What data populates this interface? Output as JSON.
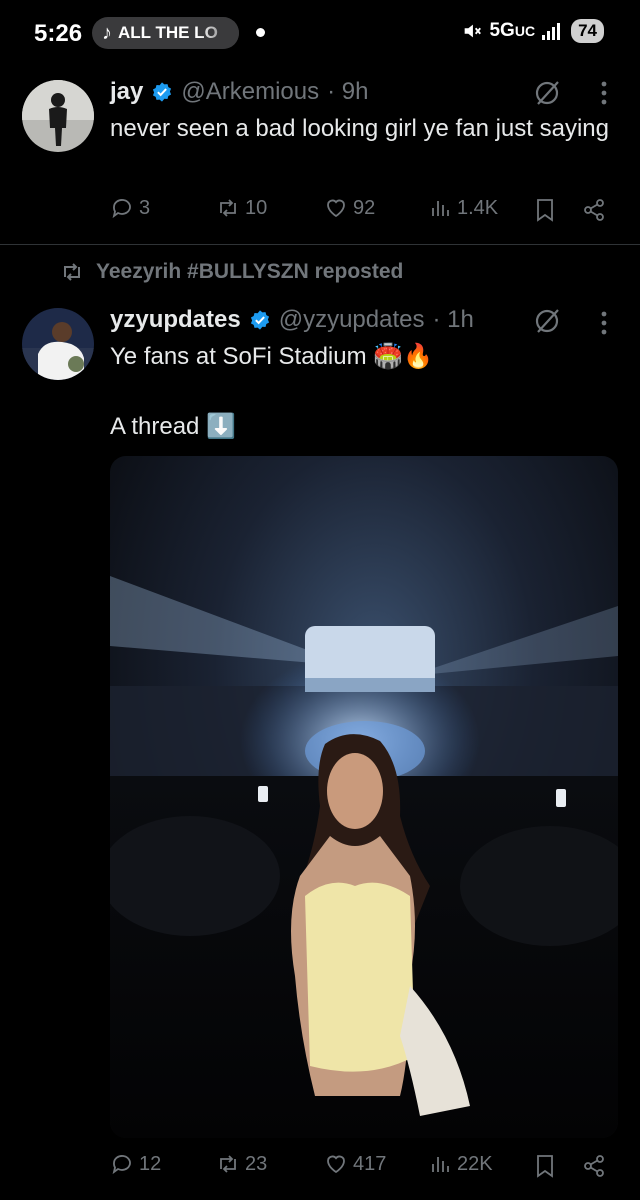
{
  "status_bar": {
    "time": "5:26",
    "media_label": "ALL THE LO",
    "network": "5G",
    "network_suffix": "UC",
    "battery": "74"
  },
  "tweet1": {
    "name": "jay",
    "handle": "@Arkemious",
    "time": "· 9h",
    "text": "never seen a bad looking girl ye fan just saying",
    "replies": "3",
    "reposts": "10",
    "likes": "92",
    "views": "1.4K"
  },
  "repost_banner": {
    "text": "Yeezyrih #BULLYSZN reposted"
  },
  "tweet2": {
    "name": "yzyupdates",
    "handle": "@yzyupdates",
    "time": "· 1h",
    "line1": "Ye fans at SoFi Stadium 🏟️🔥",
    "line2": "A thread ⬇️",
    "replies": "12",
    "reposts": "23",
    "likes": "417",
    "views": "22K"
  },
  "colors": {
    "background": "#000000",
    "text": "#e7e9ea",
    "secondary": "#71767b",
    "verified": "#1d9bf0",
    "divider": "#2f3336"
  },
  "icons": [
    "music-note-icon",
    "mute-icon",
    "signal-icon",
    "verified-icon",
    "grok-icon",
    "more-icon",
    "reply-icon",
    "repost-icon",
    "like-icon",
    "views-icon",
    "bookmark-icon",
    "share-icon"
  ]
}
